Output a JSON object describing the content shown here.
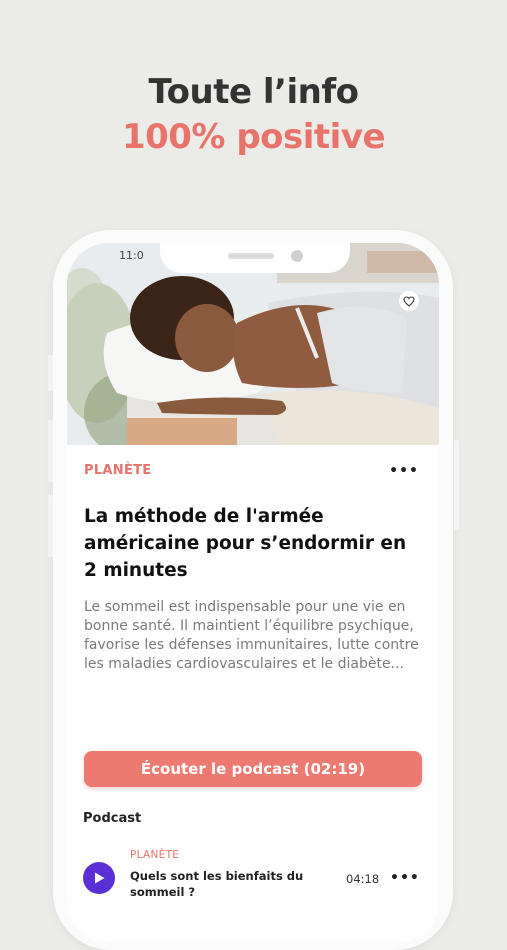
{
  "promo": {
    "headline_line1": "Toute l’info",
    "headline_line2": "100% positive",
    "accent_color": "#e8736a"
  },
  "status_bar": {
    "time": "11:0"
  },
  "article": {
    "image_icon": "heart-icon",
    "category": "PLANÈTE",
    "more_icon": "more-dots-icon",
    "more_label": "•••",
    "title": "La méthode de l'armée américaine pour s’endormir en 2 minutes",
    "excerpt": "Le sommeil est indispensable pour une vie en bonne santé. Il maintient l’équilibre psychique, favorise les défenses immunitaires, lutte contre les maladies cardiovasculaires et le diabète...",
    "cta_label": "Écouter le podcast (02:19)"
  },
  "podcast_section": {
    "label": "Podcast",
    "items": [
      {
        "icon": "play-icon",
        "category": "PLANÈTE",
        "title": "Quels sont les bienfaits du sommeil ?",
        "duration": "04:18",
        "more_label": "•••"
      }
    ]
  },
  "colors": {
    "background": "#ebebe8",
    "accent": "#e8736a",
    "cta": "#ed7a70",
    "play_button": "#5b2fd6"
  }
}
